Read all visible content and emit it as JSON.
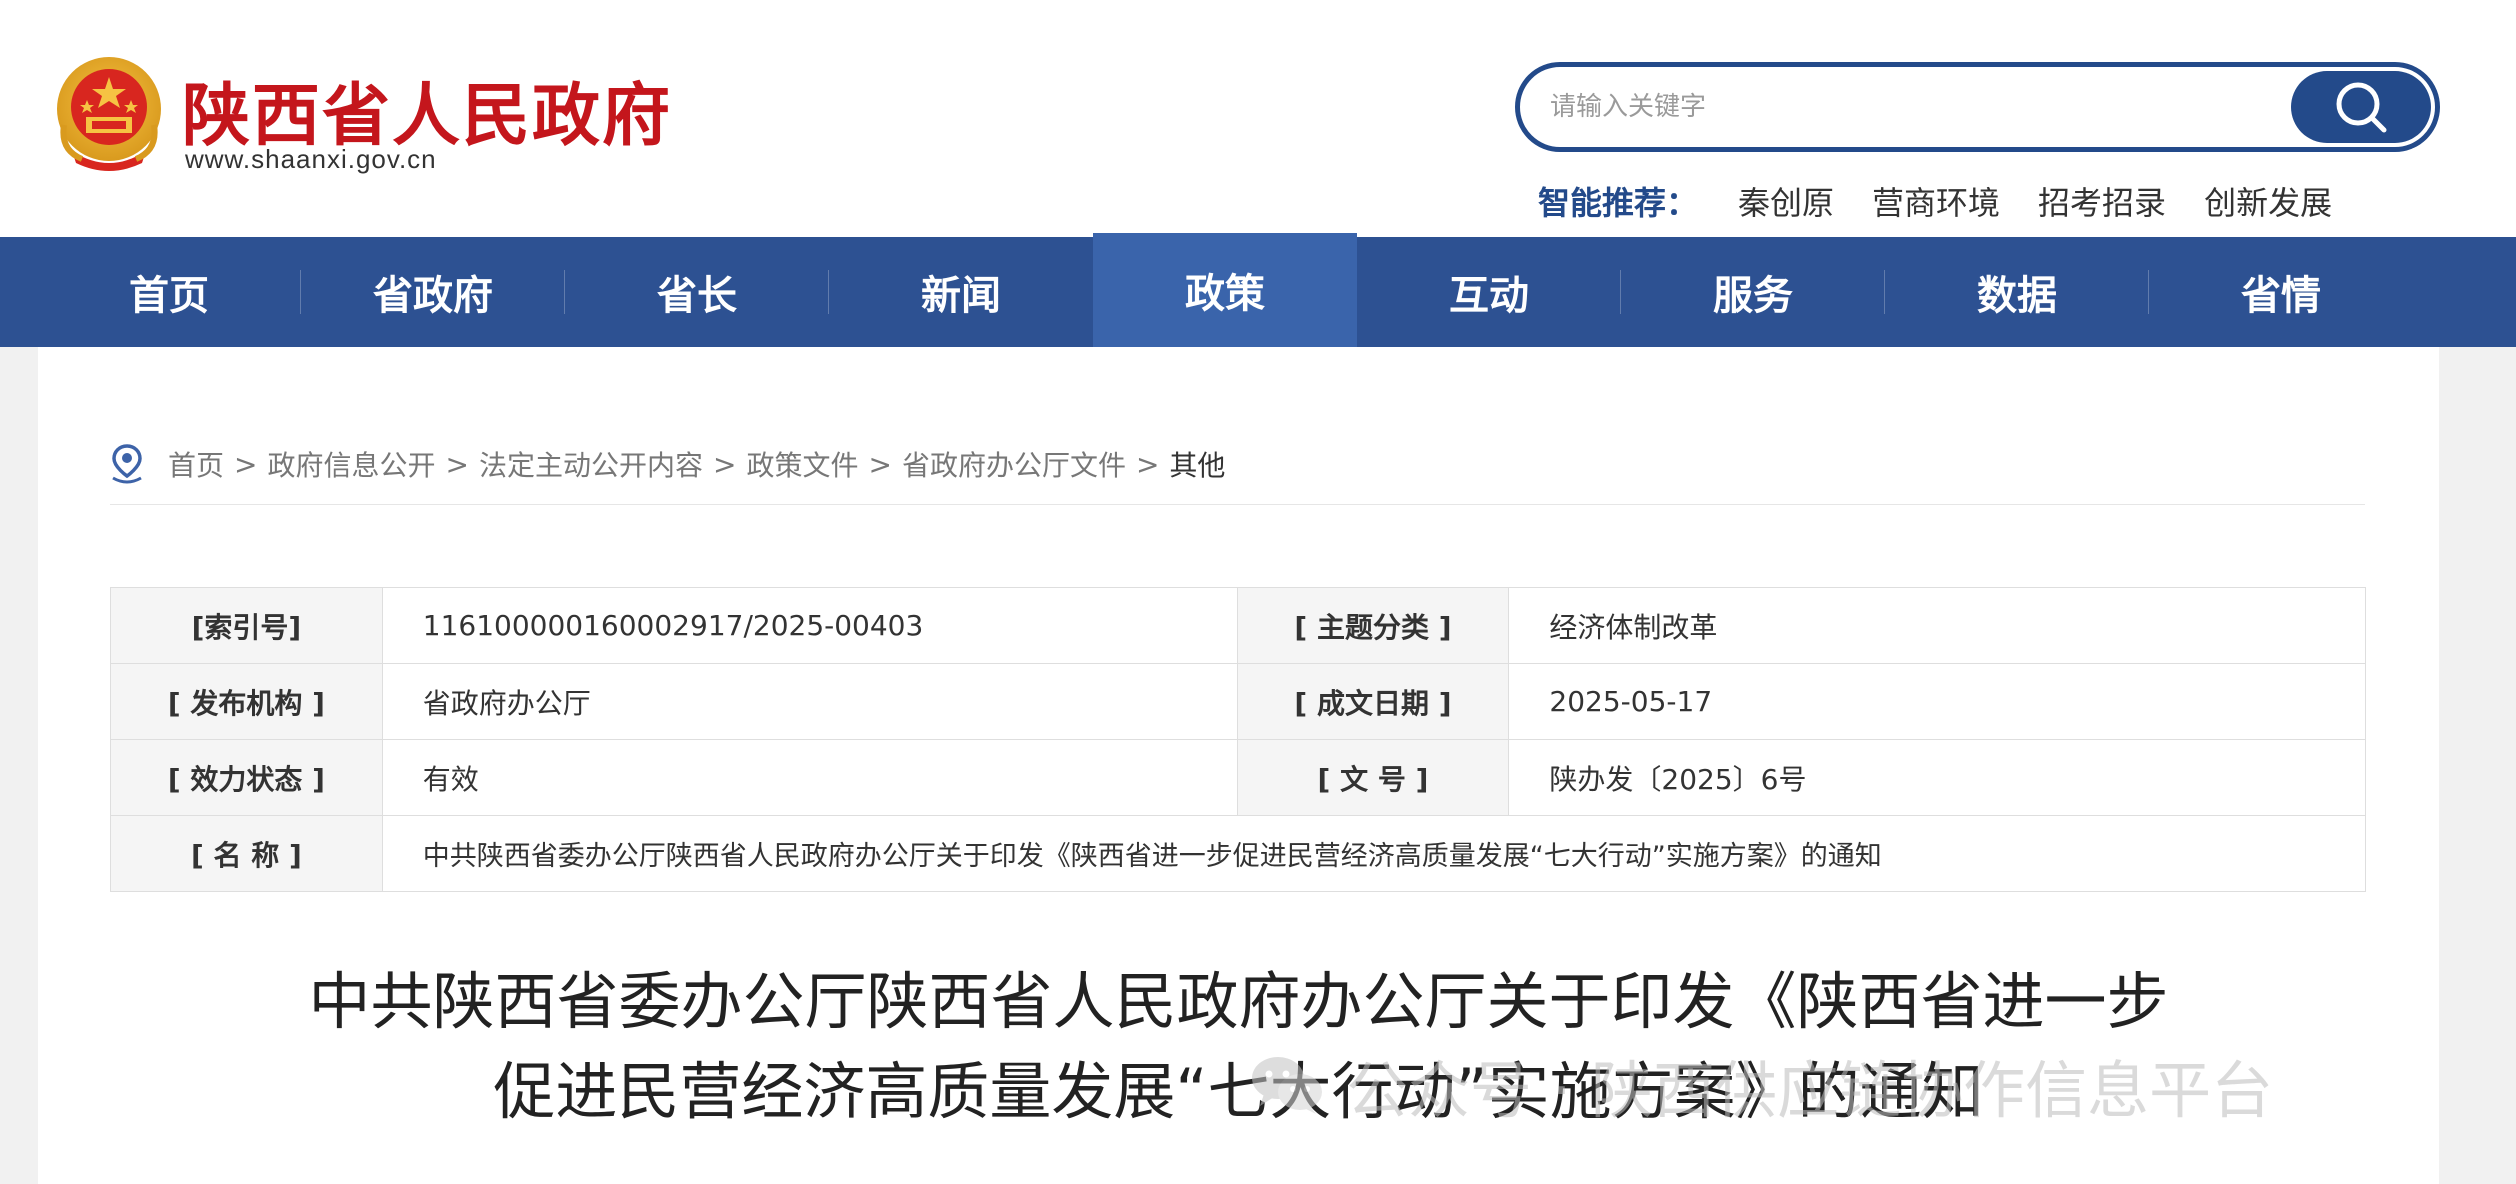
{
  "header": {
    "site_name": "陕西省人民政府",
    "site_url": "www.shaanxi.gov.cn",
    "emblem_icon": "national-emblem-icon",
    "search": {
      "placeholder": "请输入关键字",
      "button_icon": "search-icon"
    },
    "recommend": {
      "label": "智能推荐：",
      "items": [
        "秦创原",
        "营商环境",
        "招考招录",
        "创新发展"
      ]
    }
  },
  "nav": {
    "items": [
      "首页",
      "省政府",
      "省长",
      "新闻",
      "政策",
      "互动",
      "服务",
      "数据",
      "省情"
    ],
    "active": "政策"
  },
  "breadcrumb": {
    "icon": "location-pin-icon",
    "items": [
      "首页",
      "政府信息公开",
      "法定主动公开内容",
      "政策文件",
      "省政府办公厅文件",
      "其他"
    ],
    "separator": ">"
  },
  "meta": {
    "index_label": "[索引号]",
    "index_value": "116100000160002917/2025-00403",
    "topic_label": "[ 主题分类 ]",
    "topic_value": "经济体制改革",
    "publisher_label": "[ 发布机构 ]",
    "publisher_value": "省政府办公厅",
    "date_label": "[ 成文日期 ]",
    "date_value": "2025-05-17",
    "status_label": "[ 效力状态 ]",
    "status_value": "有效",
    "docno_label": "[ 文 号 ]",
    "docno_value": "陕办发〔2025〕6号",
    "name_label": "[ 名 称 ]",
    "name_value": "中共陕西省委办公厅陕西省人民政府办公厅关于印发《陕西省进一步促进民营经济高质量发展“七大行动”实施方案》的通知"
  },
  "document": {
    "title_line1": "中共陕西省委办公厅陕西省人民政府办公厅关于印发《陕西省进一步",
    "title_line2": "促进民营经济高质量发展“七大行动”实施方案》的通知"
  },
  "watermark": {
    "icon": "wechat-icon",
    "text": "公众号 · 陕西供应链协作信息平台"
  },
  "colors": {
    "brand_red": "#c4161c",
    "nav_blue": "#2d5192",
    "nav_active": "#3a64ab",
    "accent_blue": "#234a8a"
  }
}
